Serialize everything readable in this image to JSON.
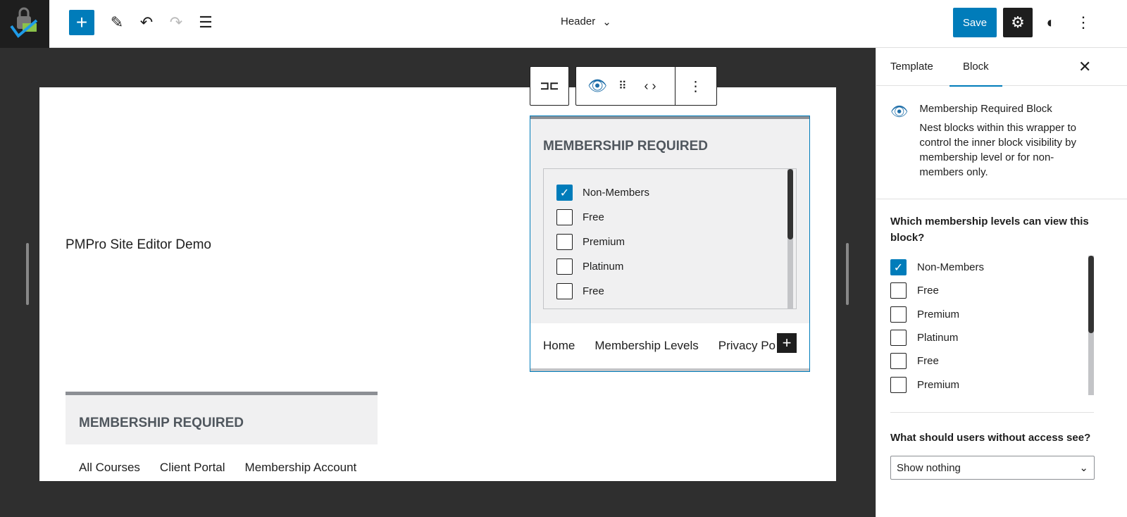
{
  "header": {
    "title": "Header",
    "save_label": "Save"
  },
  "canvas": {
    "site_title": "PMPro Site Editor Demo",
    "selected_block": {
      "title": "MEMBERSHIP REQUIRED",
      "levels": [
        {
          "label": "Non-Members",
          "checked": true
        },
        {
          "label": "Free",
          "checked": false
        },
        {
          "label": "Premium",
          "checked": false
        },
        {
          "label": "Platinum",
          "checked": false
        },
        {
          "label": "Free",
          "checked": false
        }
      ],
      "nav": [
        "Home",
        "Membership Levels",
        "Privacy Po"
      ]
    },
    "lower_block": {
      "title": "MEMBERSHIP REQUIRED",
      "nav": [
        "All Courses",
        "Client Portal",
        "Membership Account"
      ]
    }
  },
  "sidebar": {
    "tabs": [
      "Template",
      "Block"
    ],
    "active_tab": "Block",
    "block_name": "Membership Required Block",
    "block_desc": "Nest blocks within this wrapper to control the inner block visibility by membership level or for non-members only.",
    "question1": "Which membership levels can view this block?",
    "levels": [
      {
        "label": "Non-Members",
        "checked": true
      },
      {
        "label": "Free",
        "checked": false
      },
      {
        "label": "Premium",
        "checked": false
      },
      {
        "label": "Platinum",
        "checked": false
      },
      {
        "label": "Free",
        "checked": false
      },
      {
        "label": "Premium",
        "checked": false
      }
    ],
    "question2": "What should users without access see?",
    "select_value": "Show nothing"
  },
  "colors": {
    "accent": "#007cba",
    "dark": "#1e1e1e",
    "canvas": "#2f2f2f"
  }
}
